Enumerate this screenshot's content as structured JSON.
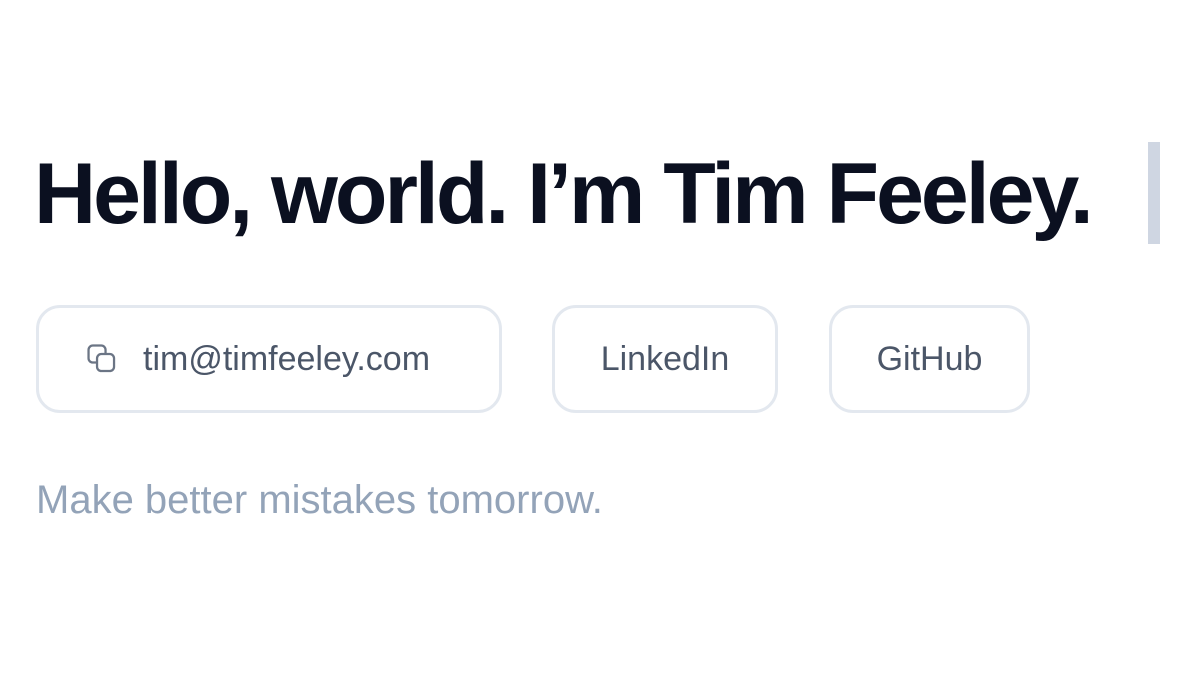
{
  "headline": {
    "text": "Hello, world. I’m Tim Feeley."
  },
  "contact": {
    "email_label": "tim@timfeeley.com",
    "email_icon": "copy-icon",
    "linkedin_label": "LinkedIn",
    "github_label": "GitHub"
  },
  "tagline": "Make better mistakes tomorrow.",
  "colors": {
    "headline": "#0b1020",
    "button_text": "#4b5668",
    "button_border": "#e3e8ef",
    "tagline": "#93a3b8",
    "cursor": "#cfd6e2"
  }
}
